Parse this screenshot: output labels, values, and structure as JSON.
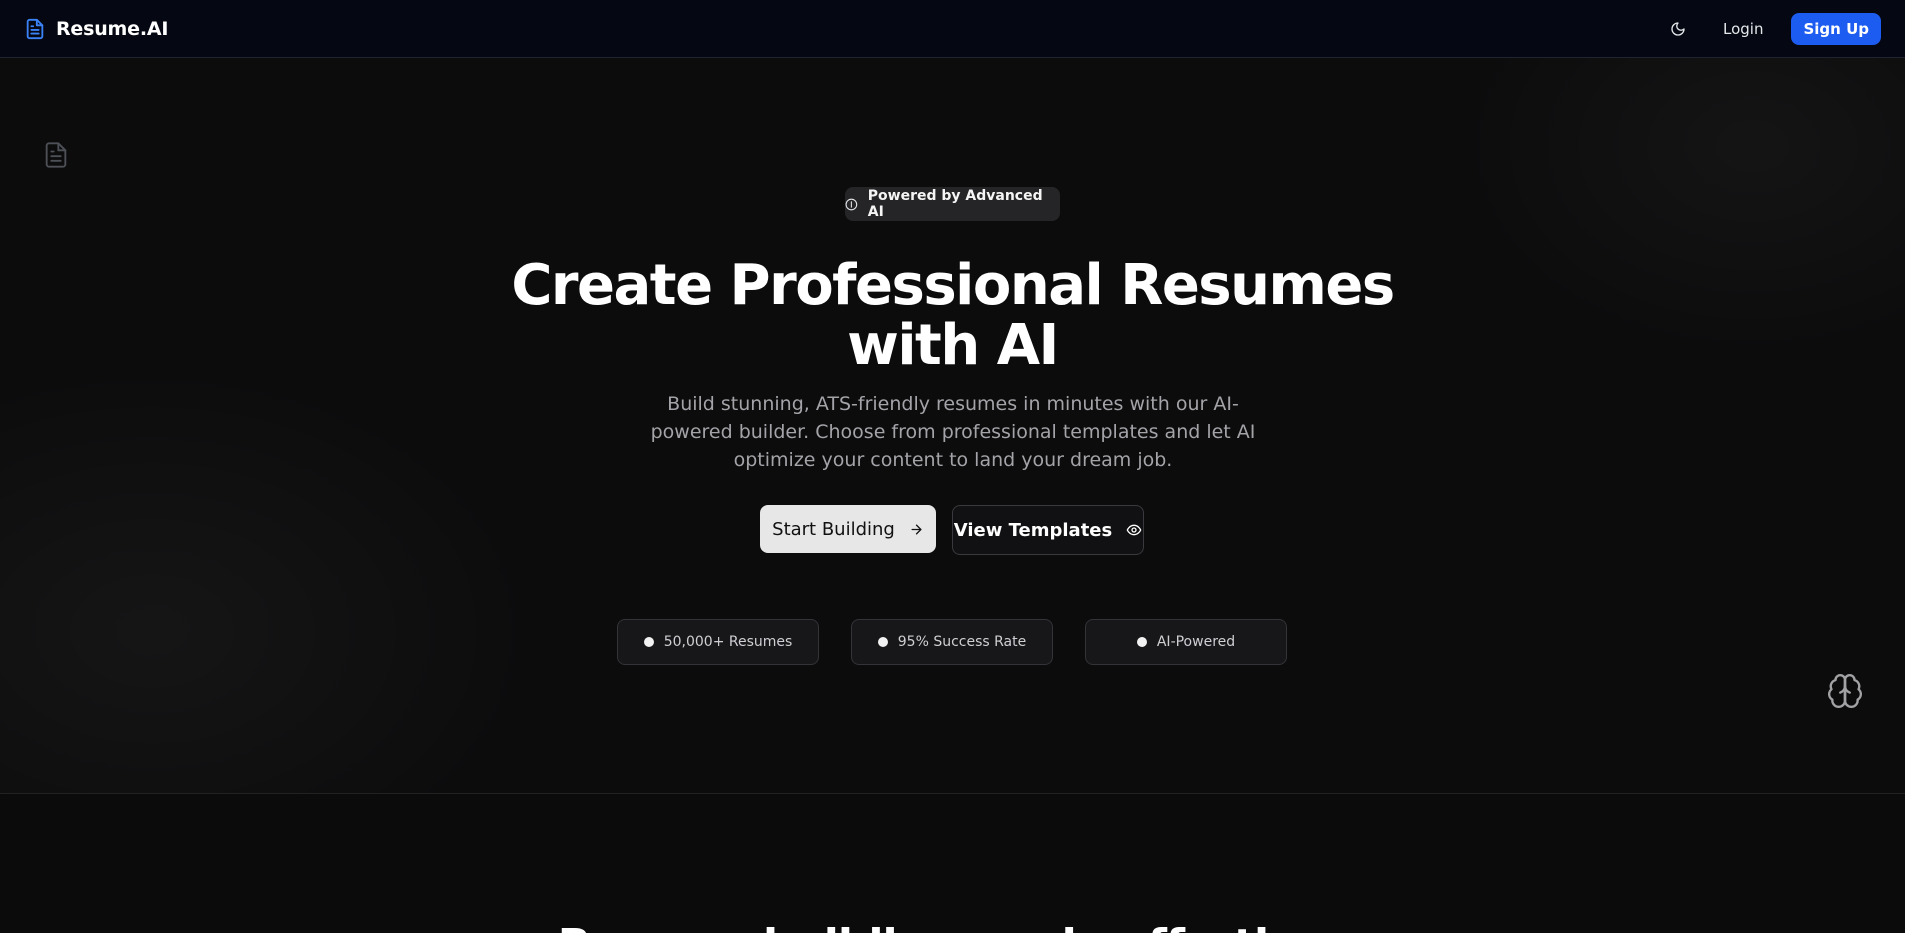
{
  "nav": {
    "brand": "Resume.AI",
    "login": "Login",
    "signup": "Sign Up",
    "theme_toggle_icon": "moon-icon",
    "brand_icon": "file-text-icon"
  },
  "hero": {
    "badge": "Powered by Advanced AI",
    "badge_icon": "info-icon",
    "headline_line1": "Create Professional Resumes",
    "headline_line2": "with AI",
    "subtext": "Build stunning, ATS-friendly resumes in minutes with our AI-powered builder. Choose from professional templates and let AI optimize your content to land your dream job.",
    "primary_cta": "Start Building",
    "primary_cta_icon": "arrow-right-icon",
    "secondary_cta": "View Templates",
    "secondary_cta_icon": "eye-icon",
    "stats": [
      {
        "label": "50,000+ Resumes"
      },
      {
        "label": "95% Success Rate"
      },
      {
        "label": "AI-Powered"
      }
    ],
    "decor_icons": [
      "file-text-icon",
      "brain-icon"
    ]
  },
  "features": {
    "title": "Resume building made effortless"
  },
  "colors": {
    "accent": "#1d5cf0",
    "background": "#0c0c0d",
    "navbar": "#050812"
  }
}
